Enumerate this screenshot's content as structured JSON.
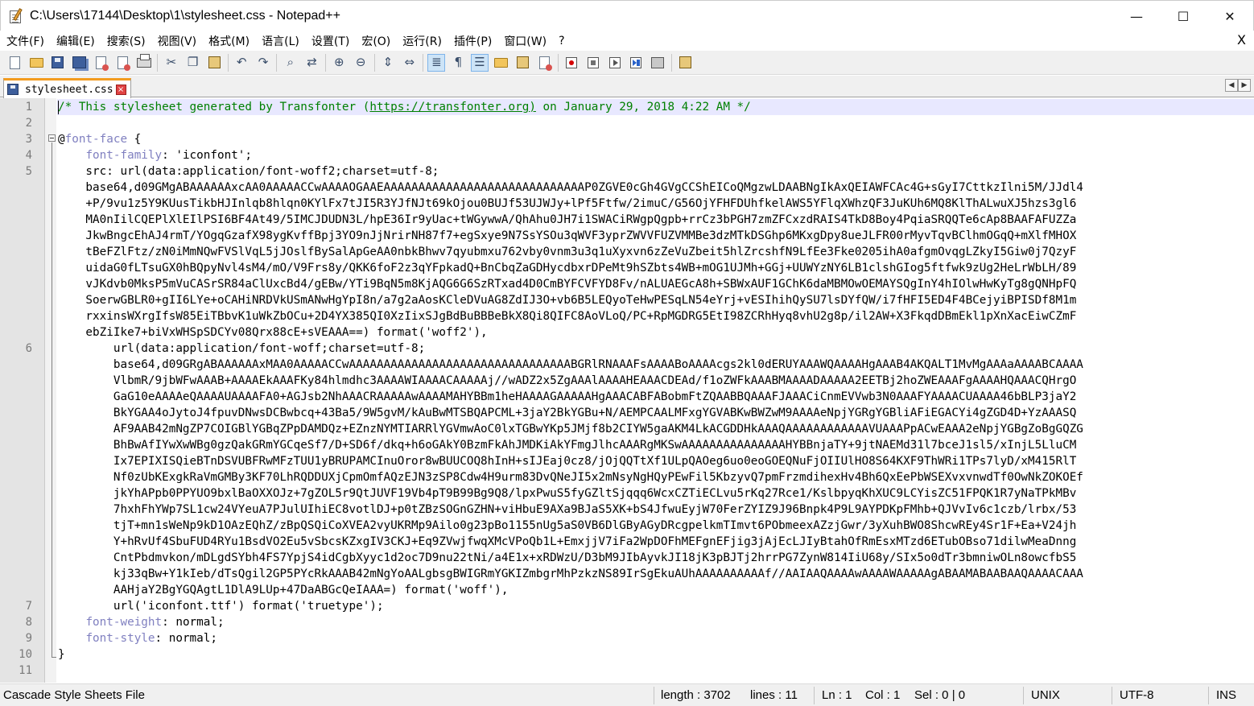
{
  "window": {
    "title": "C:\\Users\\17144\\Desktop\\1\\stylesheet.css - Notepad++",
    "minimize_glyph": "—",
    "maximize_glyph": "☐",
    "close_glyph": "✕"
  },
  "menu": {
    "items": [
      "文件(F)",
      "编辑(E)",
      "搜索(S)",
      "视图(V)",
      "格式(M)",
      "语言(L)",
      "设置(T)",
      "宏(O)",
      "运行(R)",
      "插件(P)",
      "窗口(W)",
      "?"
    ],
    "close_glyph": "X"
  },
  "toolbar": {
    "buttons": [
      "new-file-icon",
      "open-folder-icon",
      "save-icon",
      "save-all-icon",
      "close-icon",
      "close-all-icon",
      "print-icon",
      "cut-icon",
      "copy-icon",
      "paste-icon",
      "undo-icon",
      "redo-icon",
      "find-icon",
      "replace-icon",
      "zoom-in-icon",
      "zoom-out-icon",
      "sync-vertical-icon",
      "sync-horizontal-icon",
      "word-wrap-icon",
      "show-all-chars-icon",
      "indent-guide-icon",
      "doc-map-icon",
      "function-list-icon",
      "folder-workspace-icon",
      "record-macro-icon",
      "stop-macro-icon",
      "play-macro-icon",
      "run-macro-multiple-icon",
      "save-macro-icon",
      "notepad-icon"
    ],
    "active": [
      "word-wrap-icon",
      "indent-guide-icon"
    ]
  },
  "tabs": [
    {
      "label": "stylesheet.css",
      "close_glyph": "×"
    }
  ],
  "tab_arrows": {
    "left": "◀",
    "right": "▶"
  },
  "editor": {
    "lines": [
      {
        "n": "1",
        "rows": [
          [
            {
              "t": "/* This stylesheet generated by Transfonter (",
              "c": "comment"
            },
            {
              "t": "https://transfonter.org)",
              "c": "url"
            },
            {
              "t": " on January 29, 2018 4:22 AM */",
              "c": "comment"
            }
          ]
        ]
      },
      {
        "n": "2",
        "rows": [
          [
            {
              "t": "",
              "c": "val"
            }
          ]
        ]
      },
      {
        "n": "3",
        "rows": [
          [
            {
              "t": "@",
              "c": "at"
            },
            {
              "t": "font-face",
              "c": "prop"
            },
            {
              "t": " {",
              "c": "val"
            }
          ]
        ]
      },
      {
        "n": "4",
        "rows": [
          [
            {
              "t": "    ",
              "c": "val"
            },
            {
              "t": "font-family",
              "c": "prop"
            },
            {
              "t": ": 'iconfont';",
              "c": "val"
            }
          ]
        ]
      },
      {
        "n": "5",
        "rows": [
          [
            {
              "t": "    src: url(data:application/font-woff2;charset=utf-8;",
              "c": "val"
            }
          ],
          [
            {
              "t": "    base64,d09GMgABAAAAAAxcAA0AAAAACCwAAAAOGAAEAAAAAAAAAAAAAAAAAAAAAAAAAAAAAP0ZGVE0cGh4GVgCCShEICoQMgzwLDAABNgIkAxQEIAWFCAc4G+sGyI7CttkzIlni5M/JJdl4",
              "c": "val"
            }
          ],
          [
            {
              "t": "    +P/9vu1z5Y9KUusTikbHJInlqb8hlqn0KYlFx7tJI5R3YJfNJt69kOjou0BUJf53UJWJy+lPf5Ftfw/2imuC/G56OjYFHFDUhfkelAWS5YFlqXWhzQF3JuKUh6MQ8KlThALwuXJ5hzs3gl6",
              "c": "val"
            }
          ],
          [
            {
              "t": "    MA0nIilCQEPlXlEIlPSI6BF4At49/5IMCJDUDN3L/hpE36Ir9yUac+tWGywwA/QhAhu0JH7i1SWACiRWgpQgpb+rrCz3bPGH7zmZFCxzdRAIS4TkD8Boy4PqiaSRQQTe6cAp8BAAFAFUZZa",
              "c": "val"
            }
          ],
          [
            {
              "t": "    JkwBngcEhAJ4rmT/YOgqGzafX98ygKvffBpj3YO9nJjNrirNH87f7+egSxye9N7SsYSOu3qWVF3yprZWVVFUZVMMBe3dzMTkDSGhp6MKxgDpy8ueJLFR00rMyvTqvBClhmOGqQ+mXlfMHOX",
              "c": "val"
            }
          ],
          [
            {
              "t": "    tBeFZlFtz/zN0iMmNQwFVSlVqL5jJOslfBySalApGeAA0nbkBhwv7qyubmxu762vby0vnm3u3q1uXyxvn6zZeVuZbeit5hlZrcshfN9LfEe3Fke0205ihA0afgmOvqgLZkyI5Giw0j7QzyF",
              "c": "val"
            }
          ],
          [
            {
              "t": "    uidaG0fLTsuGX0hBQpyNvl4sM4/mO/V9Frs8y/QKK6foF2z3qYFpkadQ+BnCbqZaGDHycdbxrDPeMt9hSZbts4WB+mOG1UJMh+GGj+UUWYzNY6LB1clshGIog5ftfwk9zUg2HeLrWbLH/89",
              "c": "val"
            }
          ],
          [
            {
              "t": "    vJKdvb0MksP5mVuCASrSR84aClUxcBd4/gEBw/YTi9BqN5m8KjAQG6G6SzRTxad4D0CmBYFCVFYD8Fv/nALUAEGcA8h+SBWxAUF1GChK6daMBMOwOEMAYSQgInY4hIOlwHwKyTg8gQNHpFQ",
              "c": "val"
            }
          ],
          [
            {
              "t": "    SoerwGBLR0+gII6LYe+oCAHiNRDVkUSmANwHgYpI8n/a7g2aAosKCleDVuAG8ZdIJ3O+vb6B5LEQyoTeHwPESqLN54eYrj+vESIhihQySU7lsDYfQW/i7fHFI5ED4F4BCejyiBPISDf8M1m",
              "c": "val"
            }
          ],
          [
            {
              "t": "    rxxinsWXrgIfsW85EiTBbvK1uWkZbOCu+2D4YX385QI0XzIixSJgBdBuBBBeBkX8Qi8QIFC8AoVLoQ/PC+RpMGDRG5EtI98ZCRhHyq8vhU2g8p/il2AW+X3FkqdDBmEkl1pXnXacEiwCZmF",
              "c": "val"
            }
          ],
          [
            {
              "t": "    ebZiIke7+biVxWHSpSDCYv08Qrx88cE+sVEAAA==) format('woff2'),",
              "c": "val"
            }
          ]
        ]
      },
      {
        "n": "6",
        "rows": [
          [
            {
              "t": "        url(data:application/font-woff;charset=utf-8;",
              "c": "val"
            }
          ],
          [
            {
              "t": "        base64,d09GRgABAAAAAAxMAA0AAAAACCwAAAAAAAAAAAAAAAAAAAAAAAAAAAAAAAABGRlRNAAAFsAAAABoAAAAcgs2kl0dERUYAAAWQAAAAHgAAAB4AKQALT1MvMgAAAaAAAABCAAAA",
              "c": "val"
            }
          ],
          [
            {
              "t": "        VlbmR/9jbWFwAAAB+AAAAEkAAAFKy84hlmdhc3AAAAWIAAAACAAAAAj//wADZ2x5ZgAAAlAAAAHEAAACDEAd/f1oZWFkAAABMAAAADAAAAA2EETBj2hoZWEAAAFgAAAAHQAAACQHrgO",
              "c": "val"
            }
          ],
          [
            {
              "t": "        GaG10eAAAAeQAAAAUAAAAFA0+AGJsb2NhAAACRAAAAAwAAAAMAHYBBm1heHAAAAGAAAAAHgAAACABFABobmFtZQAABBQAAAFJAAACiCnmEVVwb3N0AAAFYAAAACUAAAA46bBLP3jaY2",
              "c": "val"
            }
          ],
          [
            {
              "t": "        BkYGAA4oJytoJ4fpuvDNwsDCBwbcq+43Ba5/9W5gvM/kAuBwMTSBQAPCML+3jaY2BkYGBu+N/AEMPCAALMFxgYGVABKwBWZwM9AAAAeNpjYGRgYGBliAFiEGACYi4gZGD4D+YzAAASQ",
              "c": "val"
            }
          ],
          [
            {
              "t": "        AF9AAB42mNgZP7COIGBlYGBqZPpDAMDQz+EZnzNYMTIARRlYGVmwAoC0lxTGBwYKp5JMjf8b2CIYW5gaAKM4LkACGDDHkAAAQAAAAAAAAAAAAVUAAAPpACwEAAA2eNpjYGBgZoBgGQZG",
              "c": "val"
            }
          ],
          [
            {
              "t": "        BhBwAfIYwXwWBg0gzQakGRmYGCqeSf7/D+SD6f/dkq+h6oGAkY0BzmFkAhJMDKiAkYFmgJlhcAAARgMKSwAAAAAAAAAAAAAAAHYBBnjaTY+9jtNAEMd31l7bceJ1sl5/xInjL5LluCM",
              "c": "val"
            }
          ],
          [
            {
              "t": "        Ix7EPIXISQieBTnDSVUBFRwMFzTUU1yBRUPAMCInuOror8wBUUCOQ8hInH+sIJEaj0cz8/jOjQQTtXf1ULpQAOeg6uo0eoGOEQNuFjOIIUlHO8S64KXF9ThWRi1TPs7lyD/xM415RlT",
              "c": "val"
            }
          ],
          [
            {
              "t": "        Nf0zUbKExgkRaVmGMBy3KF70LhRQDDUXjCpmOmfAQzEJN3zSP8Cdw4H9urm83DvQNeJI5x2mNsyNgHQyPEwFil5KbzyvQ7pmFrzmdihexHv4Bh6QxEePbWSEXvxvnwdTf0OwNkZOKOEf",
              "c": "val"
            }
          ],
          [
            {
              "t": "        jkYhAPpb0PPYUO9bxlBaOXXOJz+7gZOL5r9QtJUVF19Vb4pT9B99Bg9Q8/lpxPwuS5fyGZltSjqqq6WcxCZTiECLvu5rKq27Rce1/KslbpyqKhXUC9LCYisZC51FPQK1R7yNaTPkMBv",
              "c": "val"
            }
          ],
          [
            {
              "t": "        7hxhFhYWp7SL1cw24VYeuA7PJulUIhiEC8votlDJ+p0tZBzSOGnGZHN+viHbuE9AXa9BJaS5XK+bS4JfwuEyjW70FerZYIZ9J96Bnpk4P9L9AYPDKpFMhb+QJVvIv6c1czb/lrbx/53",
              "c": "val"
            }
          ],
          [
            {
              "t": "        tjT+mn1sWeNp9kD1OAzEQhZ/zBpQSQiCoXVEA2vyUKRMp9Ailo0g23pBo1155nUg5aS0VB6DlGByAGyDRcgpelkmTImvt6PObmeexAZzjGwr/3yXuhBWO8ShcwREy4Sr1F+Ea+V24jh",
              "c": "val"
            }
          ],
          [
            {
              "t": "        Y+hRvUf4SbuFUD4RYu1BsdVO2Eu5vSbcsKZxgIV3CKJ+Eq9ZVwjfwqXMcVPoQb1L+EmxjjV7iFa2WpDOFhMEFgnEFjig3jAjEcLJIyBtahOfRmEsxMTzd6ETubOBso71dilwMeaDnng",
              "c": "val"
            }
          ],
          [
            {
              "t": "        CntPbdmvkon/mDLgdSYbh4FS7YpjS4idCgbXyyc1d2oc7D9nu22tNi/a4E1x+xRDWzU/D3bM9JIbAyvkJI18jK3pBJTj2hrrPG7ZynW814IiU68y/SIx5o0dTr3bmniwOLn8owcfbS5",
              "c": "val"
            }
          ],
          [
            {
              "t": "        kj33qBw+Y1kIeb/dTsQgil2GP5PYcRkAAAB42mNgYoAALgbsgBWIGRmYGKIZmbgrMhPzkzNS89IrSgEkuAUhAAAAAAAAAAf//AAIAAQAAAAwAAAAWAAAAAgABAAMABAABAAQAAAACAAA",
              "c": "val"
            }
          ],
          [
            {
              "t": "        AAHjaY2BgYGQAgtL1DlA9LUp+47DaABGcQeIAAA=) format('woff'),",
              "c": "val"
            }
          ]
        ]
      },
      {
        "n": "7",
        "rows": [
          [
            {
              "t": "        url('iconfont.ttf') format('truetype');",
              "c": "val"
            }
          ]
        ]
      },
      {
        "n": "8",
        "rows": [
          [
            {
              "t": "    ",
              "c": "val"
            },
            {
              "t": "font-weight",
              "c": "prop"
            },
            {
              "t": ": normal;",
              "c": "val"
            }
          ]
        ]
      },
      {
        "n": "9",
        "rows": [
          [
            {
              "t": "    ",
              "c": "val"
            },
            {
              "t": "font-style",
              "c": "prop"
            },
            {
              "t": ": normal;",
              "c": "val"
            }
          ]
        ]
      },
      {
        "n": "10",
        "rows": [
          [
            {
              "t": "}",
              "c": "val"
            }
          ]
        ]
      },
      {
        "n": "11",
        "rows": [
          [
            {
              "t": "",
              "c": "val"
            }
          ]
        ]
      }
    ]
  },
  "status": {
    "file_type": "Cascade Style Sheets File",
    "length": "length : 3702",
    "lines": "lines : 11",
    "ln": "Ln : 1",
    "col": "Col : 1",
    "sel": "Sel : 0 | 0",
    "eol": "UNIX",
    "encoding": "UTF-8",
    "mode": "INS"
  }
}
